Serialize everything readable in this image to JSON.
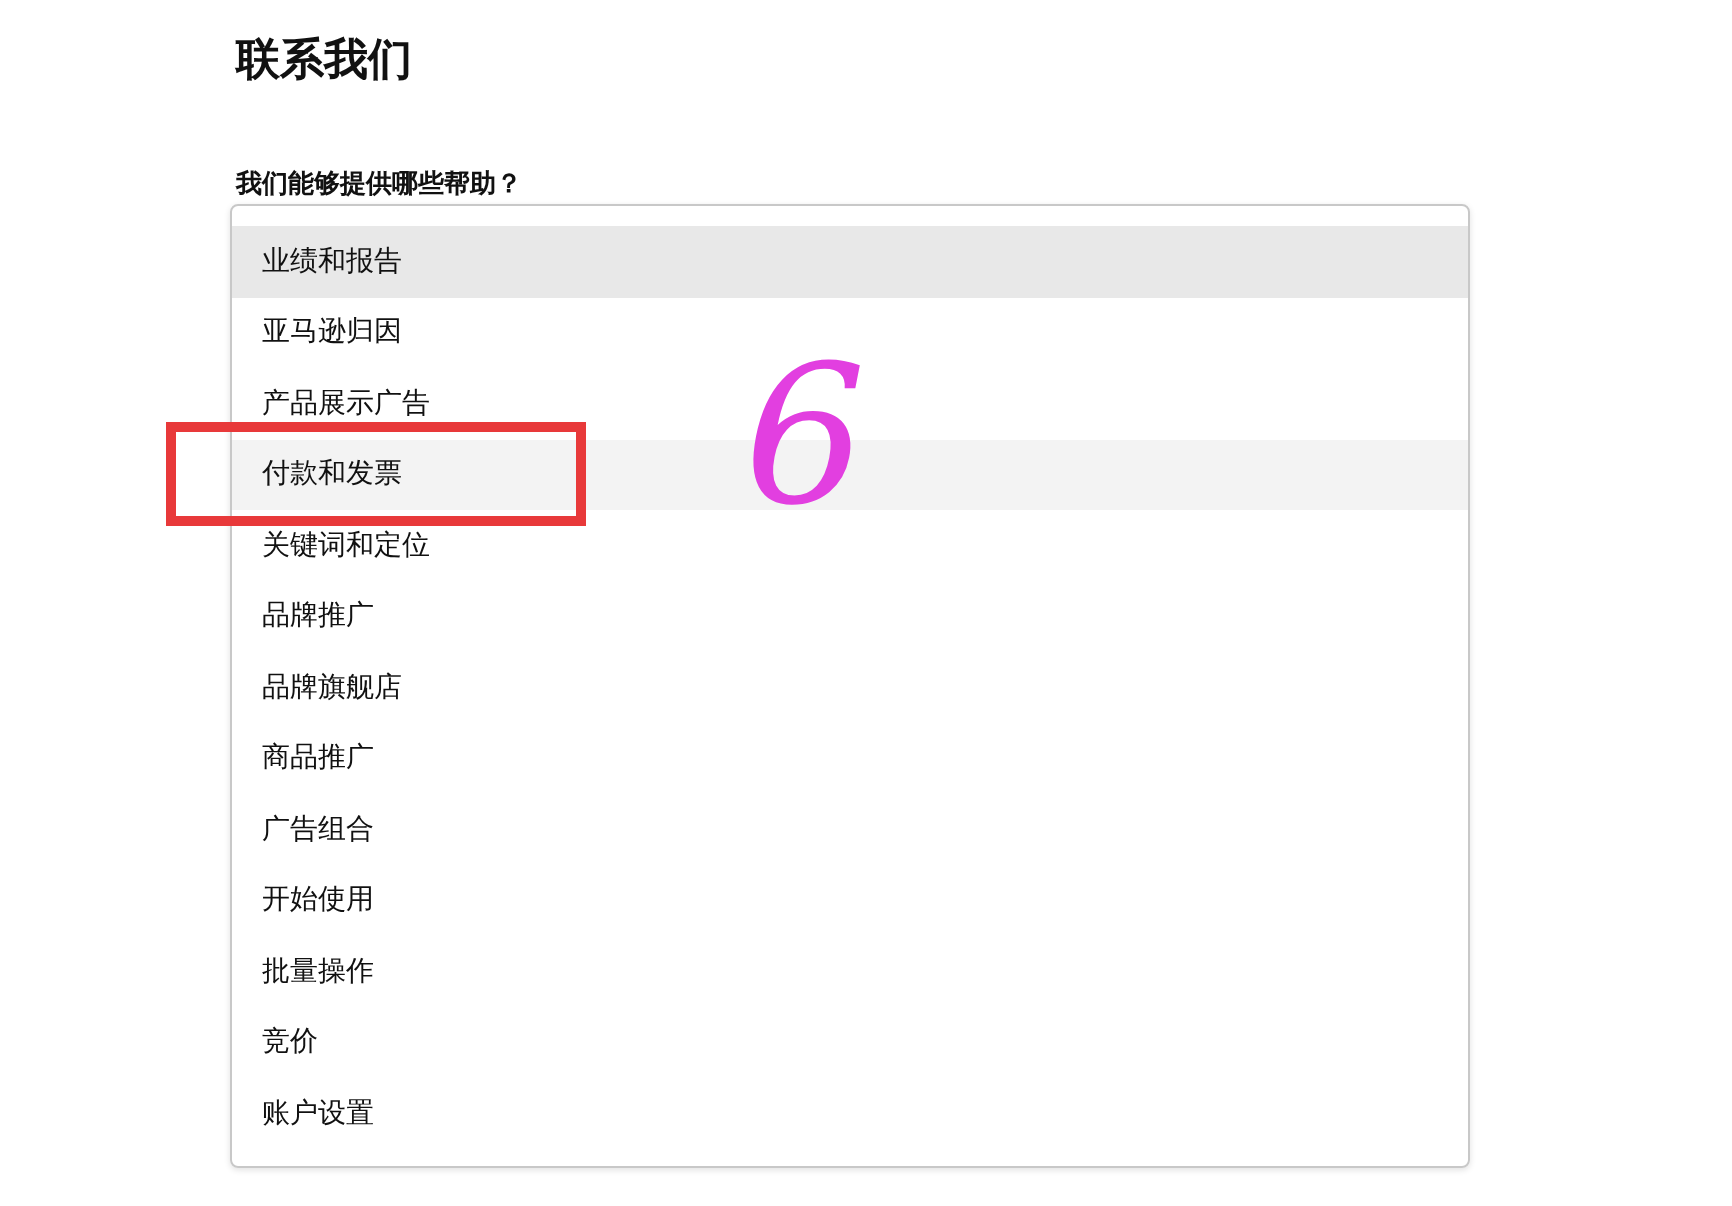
{
  "title": "联系我们",
  "question": {
    "label": "我们能够提供哪些帮助？",
    "options": [
      {
        "label": "业绩和报告",
        "selected": true,
        "hovered": false
      },
      {
        "label": "亚马逊归因",
        "selected": false,
        "hovered": false
      },
      {
        "label": "产品展示广告",
        "selected": false,
        "hovered": false
      },
      {
        "label": "付款和发票",
        "selected": false,
        "hovered": true,
        "boxed": true
      },
      {
        "label": "关键词和定位",
        "selected": false,
        "hovered": false
      },
      {
        "label": "品牌推广",
        "selected": false,
        "hovered": false
      },
      {
        "label": "品牌旗舰店",
        "selected": false,
        "hovered": false
      },
      {
        "label": "商品推广",
        "selected": false,
        "hovered": false
      },
      {
        "label": "广告组合",
        "selected": false,
        "hovered": false
      },
      {
        "label": "开始使用",
        "selected": false,
        "hovered": false
      },
      {
        "label": "批量操作",
        "selected": false,
        "hovered": false
      },
      {
        "label": "竞价",
        "selected": false,
        "hovered": false
      },
      {
        "label": "账户设置",
        "selected": false,
        "hovered": false
      }
    ]
  },
  "annotation": {
    "text": "6"
  }
}
